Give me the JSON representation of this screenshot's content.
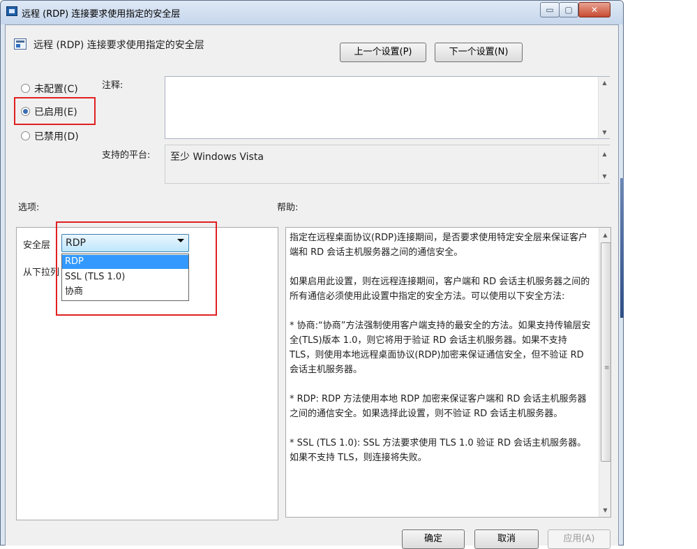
{
  "window": {
    "title": "远程 (RDP) 连接要求使用指定的安全层",
    "caption_buttons": {
      "minimize": "▭",
      "maximize": "▢",
      "close": "✕"
    }
  },
  "header": {
    "icon": "policy-setting-icon",
    "title": "远程 (RDP) 连接要求使用指定的安全层",
    "prev_button": "上一个设置(P)",
    "next_button": "下一个设置(N)"
  },
  "state_radios": [
    {
      "label": "未配置(C)",
      "checked": false
    },
    {
      "label": "已启用(E)",
      "checked": true
    },
    {
      "label": "已禁用(D)",
      "checked": false
    }
  ],
  "comment": {
    "label": "注释:",
    "value": ""
  },
  "platform": {
    "label": "支持的平台:",
    "value": "至少 Windows Vista"
  },
  "options": {
    "label": "选项:",
    "security_layer_label": "安全层",
    "selected": "RDP",
    "dropdown_options": [
      "RDP",
      "SSL (TLS 1.0)",
      "协商"
    ],
    "hint": "从下拉列"
  },
  "help": {
    "label": "帮助:",
    "paragraphs": [
      "指定在远程桌面协议(RDP)连接期间，是否要求使用特定安全层来保证客户端和 RD 会话主机服务器之间的通信安全。",
      "如果启用此设置，则在远程连接期间，客户端和 RD 会话主机服务器之间的所有通信必须使用此设置中指定的安全方法。可以使用以下安全方法:",
      "* 协商:“协商”方法强制使用客户端支持的最安全的方法。如果支持传输层安全(TLS)版本 1.0，则它将用于验证 RD 会话主机服务器。如果不支持 TLS，则使用本地远程桌面协议(RDP)加密来保证通信安全，但不验证 RD 会话主机服务器。",
      "* RDP: RDP 方法使用本地 RDP 加密来保证客户端和 RD 会话主机服务器之间的通信安全。如果选择此设置，则不验证 RD 会话主机服务器。",
      "* SSL (TLS 1.0): SSL 方法要求使用 TLS 1.0 验证 RD 会话主机服务器。如果不支持 TLS，则连接将失败。"
    ]
  },
  "footer": {
    "ok": "确定",
    "cancel": "取消",
    "apply": "应用(A)"
  },
  "colors": {
    "highlight_box": "#e02020",
    "selection": "#3399ff"
  }
}
